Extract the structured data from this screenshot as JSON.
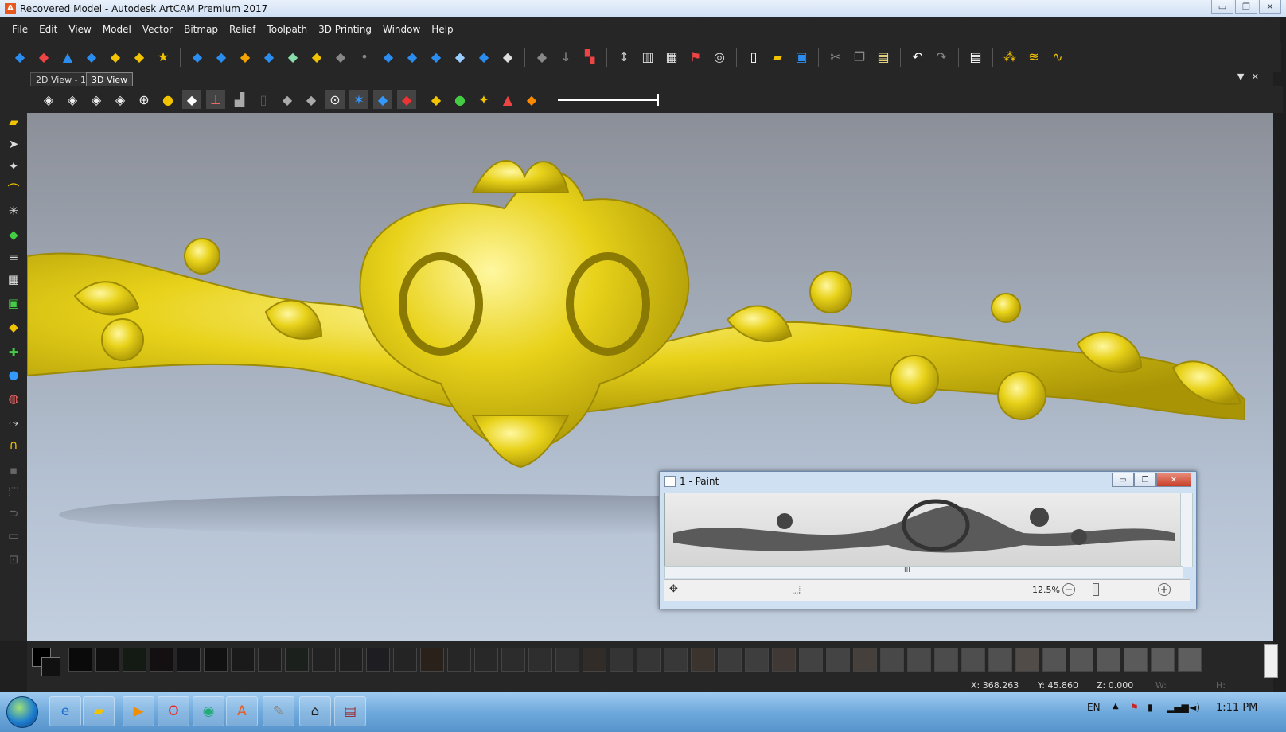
{
  "window": {
    "title": "Recovered Model - Autodesk ArtCAM Premium 2017",
    "controls": [
      "▭",
      "❐",
      "✕"
    ]
  },
  "menu": [
    "File",
    "Edit",
    "View",
    "Model",
    "Vector",
    "Bitmap",
    "Relief",
    "Toolpath",
    "3D Printing",
    "Window",
    "Help"
  ],
  "toolbar_icons": [
    "◆",
    "◆",
    "◆",
    "◆",
    "◆",
    "◆",
    "◆",
    "◆",
    "◆",
    "◆",
    "◆",
    "◆",
    "◆",
    "◆",
    "◆",
    "◆",
    "◆",
    "◆",
    "◆",
    "◆",
    "◆",
    "◆",
    "◆",
    "◆",
    "◆",
    "◆",
    "◆",
    "◆",
    "◆",
    "◆",
    "◆",
    "◆",
    "◆",
    "◆",
    "◆",
    "◆",
    "◆"
  ],
  "tabs": [
    {
      "label": "2D View - 1"
    },
    {
      "label": "3D View"
    }
  ],
  "view_toolbar": {
    "icons": [
      "cube",
      "cube",
      "cube",
      "cube",
      "zoom",
      "bulb",
      "flat",
      "axes",
      "paint",
      "mask",
      "plane",
      "plane",
      "rotate",
      "star",
      "layer",
      "layer",
      "layer",
      "layer",
      "layer",
      "layer",
      "layer"
    ],
    "slider_level": 1.0
  },
  "paint_window": {
    "title": "1 - Paint",
    "zoom": "12.5%",
    "minus": "−",
    "plus": "+",
    "scroll_mark": "III"
  },
  "status": {
    "x": "X: 368.263",
    "y": "Y: 45.860",
    "z": "Z: 0.000",
    "w": "W:",
    "h": "H:"
  },
  "taskbar": {
    "lang": "EN",
    "time": "1:11 PM"
  },
  "colors": {
    "relief_gold": "#e8d21a",
    "relief_shadow": "#a89405",
    "ui_dark": "#262626"
  }
}
